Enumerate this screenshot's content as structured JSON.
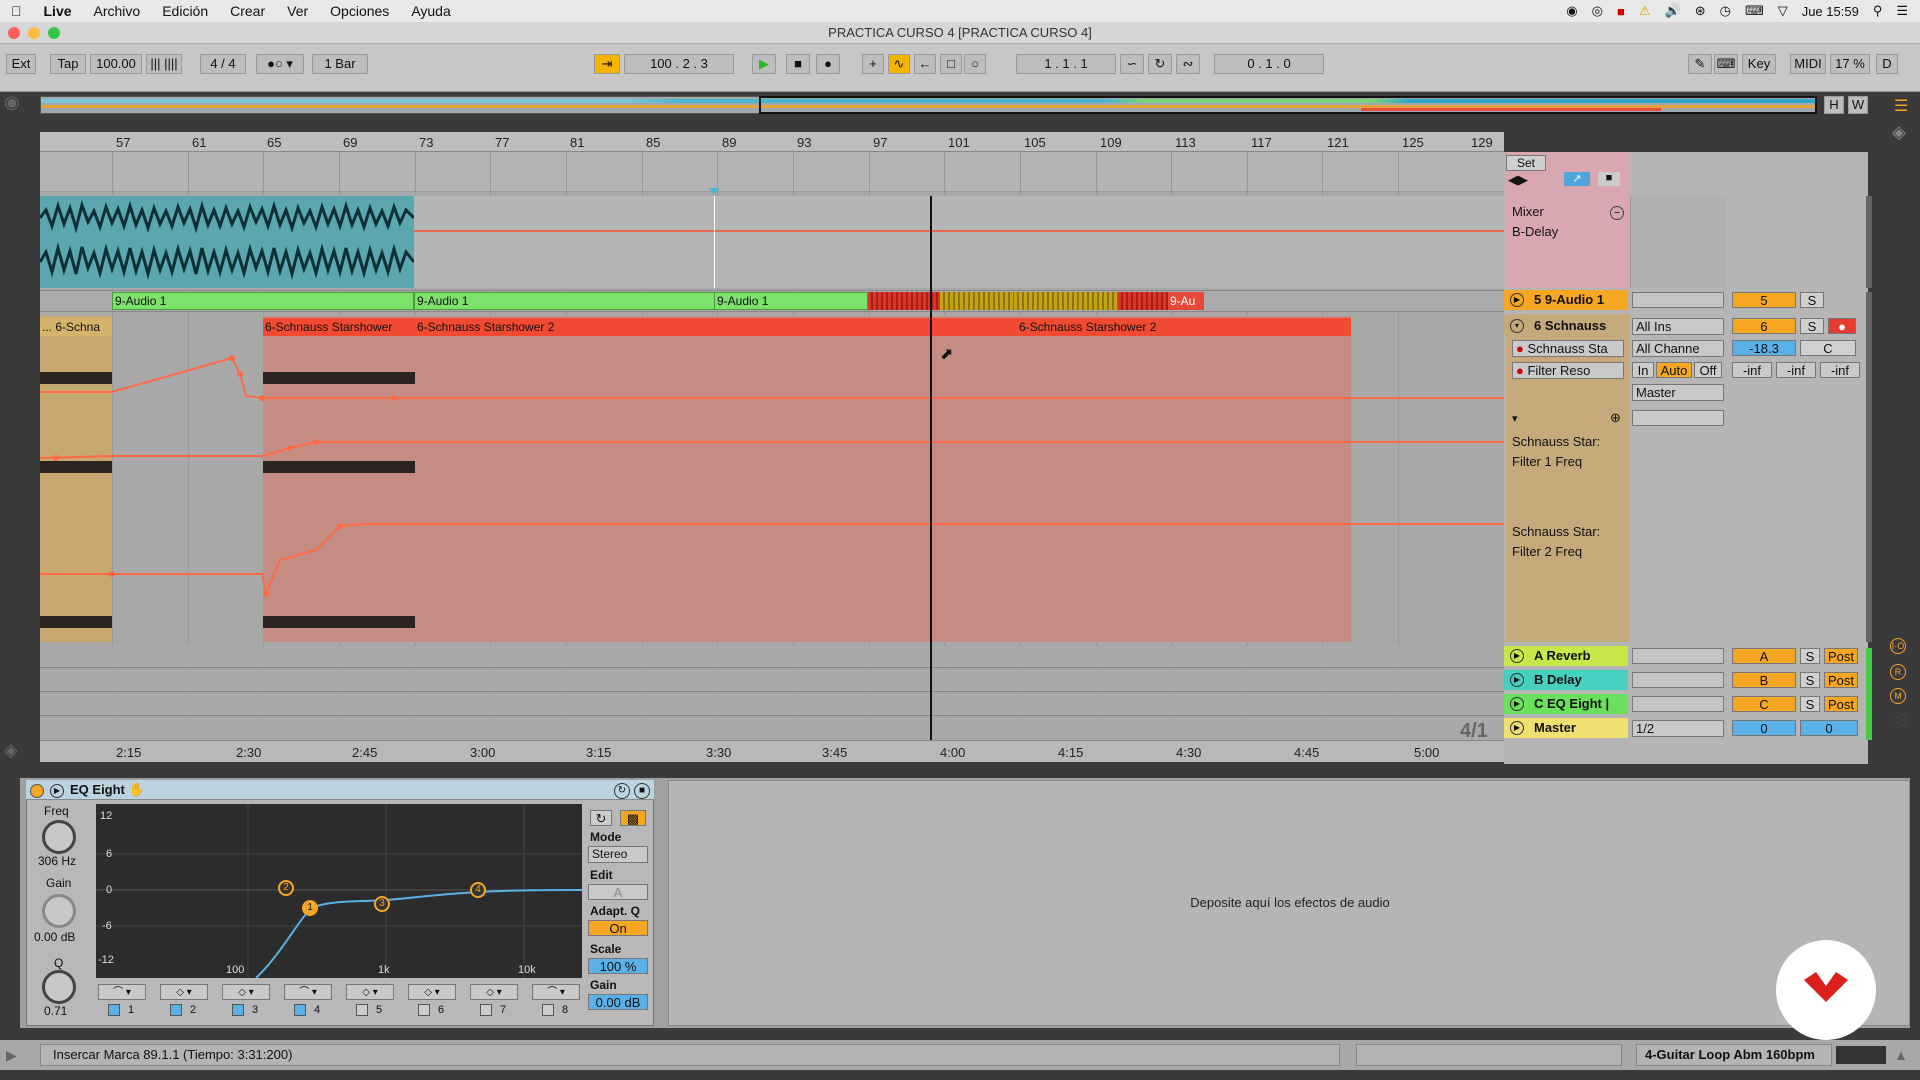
{
  "menubar": {
    "app": "Live",
    "items": [
      "Archivo",
      "Edición",
      "Crear",
      "Ver",
      "Opciones",
      "Ayuda"
    ],
    "clock": "Jue 15:59"
  },
  "window": {
    "title": "PRACTICA CURSO 4  [PRACTICA CURSO 4]"
  },
  "transport": {
    "ext": "Ext",
    "tap": "Tap",
    "tempo": "100.00",
    "signature": "4 / 4",
    "quantize": "1 Bar",
    "position": "100 .  2 .  3",
    "loop_start": "1 .  1 .  1",
    "loop_length": "0 .  1 .  0",
    "key": "Key",
    "midi": "MIDI",
    "cpu": "17 %",
    "d": "D",
    "h": "H",
    "w": "W"
  },
  "ruler": {
    "bars": [
      "57",
      "61",
      "65",
      "69",
      "73",
      "77",
      "81",
      "85",
      "89",
      "93",
      "97",
      "101",
      "105",
      "109",
      "113",
      "117",
      "121",
      "125",
      "129"
    ]
  },
  "timeline": {
    "times": [
      "2:15",
      "2:30",
      "2:45",
      "3:00",
      "3:15",
      "3:30",
      "3:45",
      "4:00",
      "4:15",
      "4:30",
      "4:45",
      "5:00"
    ],
    "zoom": "4/1"
  },
  "clips": {
    "audio1": "9-Audio 1",
    "audio1_short": "9-Au",
    "schnauss1": "6-Schnauss Starshower",
    "schnauss2": "6-Schnauss Starshower 2",
    "schnauss_left": "... 6-Schna"
  },
  "set_button": "Set",
  "mixer": {
    "group_top": {
      "line1": "Mixer",
      "line2": "B-Delay"
    },
    "track5": {
      "name": "5 9-Audio 1",
      "num": "5",
      "solo": "S"
    },
    "track6": {
      "name": "6 Schnauss",
      "num": "6",
      "solo": "S",
      "input": "All Ins",
      "channel": "All Channe",
      "device": "Schnauss Sta",
      "param": "Filter Reso",
      "volume": "-18.3",
      "pan": "C",
      "in": "In",
      "auto": "Auto",
      "off": "Off",
      "inf1": "-inf",
      "inf2": "-inf",
      "inf3": "-inf",
      "output": "Master",
      "lane1_a": "Schnauss Star:",
      "lane1_b": "Filter 1 Freq",
      "lane2_a": "Schnauss Star:",
      "lane2_b": "Filter 2 Freq"
    },
    "returns": [
      {
        "name": "A Reverb",
        "letter": "A",
        "solo": "S",
        "post": "Post"
      },
      {
        "name": "B Delay",
        "letter": "B",
        "solo": "S",
        "post": "Post"
      },
      {
        "name": "C EQ Eight |",
        "letter": "C",
        "solo": "S",
        "post": "Post"
      }
    ],
    "master": {
      "name": "Master",
      "cue": "1/2",
      "v1": "0",
      "v2": "0"
    }
  },
  "eq": {
    "title": "EQ Eight",
    "freq_label": "Freq",
    "freq": "306 Hz",
    "gain_label": "Gain",
    "gain": "0.00 dB",
    "q_label": "Q",
    "q": "0.71",
    "db_ticks": [
      "12",
      "6",
      "0",
      "-6",
      "-12"
    ],
    "freq_ticks": [
      "100",
      "1k",
      "10k"
    ],
    "mode_label": "Mode",
    "mode": "Stereo",
    "edit_label": "Edit",
    "edit": "A",
    "adaptq_label": "Adapt. Q",
    "adaptq": "On",
    "scale_label": "Scale",
    "scale": "100 %",
    "outgain_label": "Gain",
    "outgain": "0.00 dB",
    "bands": [
      "1",
      "2",
      "3",
      "4",
      "5",
      "6",
      "7",
      "8"
    ]
  },
  "drop_hint": "Deposite aquí los efectos de audio",
  "status": {
    "message": "Insercar Marca 89.1.1 (Tiempo: 3:31:200)",
    "clip": "4-Guitar Loop Abm 160bpm"
  }
}
